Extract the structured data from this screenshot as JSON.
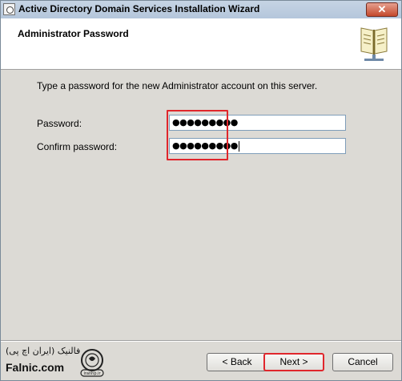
{
  "window": {
    "title": "Active Directory Domain Services Installation Wizard",
    "close_glyph": "✕"
  },
  "header": {
    "title": "Administrator Password",
    "icon": "book-icon"
  },
  "body": {
    "intro": "Type a password for the new Administrator account on this server.",
    "password_label": "Password:",
    "password_value": "●●●●●●●●●",
    "confirm_label": "Confirm password:",
    "confirm_value": "●●●●●●●●●"
  },
  "buttons": {
    "back": "< Back",
    "next": "Next >",
    "cancel": "Cancel"
  },
  "watermark": {
    "script_text": "فالنیک (ایران اچ پی)",
    "brand": "Falnic.com",
    "seal": "iranhp.ir"
  },
  "colors": {
    "highlight": "#e0262c"
  }
}
